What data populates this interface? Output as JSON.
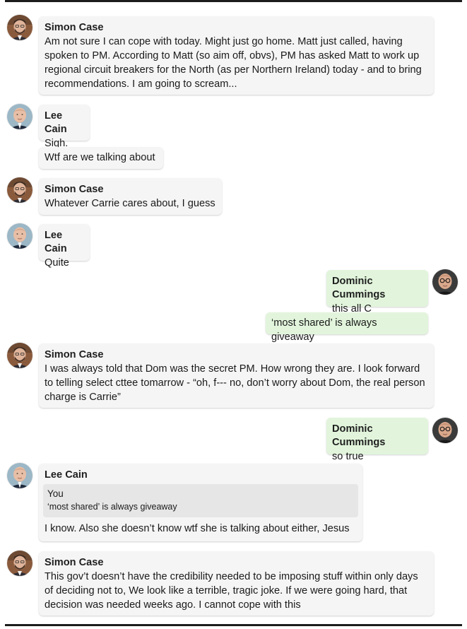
{
  "messages": [
    {
      "sender": "Simon Case",
      "text": "Am not sure I can cope with today. Might just go home. Matt just called, having spoken to PM. According to Matt (so aim off, obvs), PM has asked Matt to work up regional circuit breakers for the North (as per Northern Ireland) today - and to bring recommendations. I am going to scream..."
    },
    {
      "sender": "Lee Cain",
      "text": "Sigh."
    },
    {
      "sender": "",
      "text": "Wtf are we talking about"
    },
    {
      "sender": "Simon Case",
      "text": "Whatever Carrie cares about, I guess"
    },
    {
      "sender": "Lee Cain",
      "text": "Quite"
    },
    {
      "sender": "Dominic Cummings",
      "text": "this all C"
    },
    {
      "sender": "",
      "text": "‘most shared’ is always giveaway"
    },
    {
      "sender": "Simon Case",
      "text": "I was always told that Dom was the secret PM. How wrong they are. I look forward to telling select cttee tomarrow - “oh, f--- no, don’t worry about Dom, the real person charge is Carrie”"
    },
    {
      "sender": "Dominic Cummings",
      "text": "so true"
    },
    {
      "sender": "Lee Cain",
      "reply_to": {
        "name": "You",
        "text": "‘most shared’ is always giveaway"
      },
      "text": "I know. Also she doesn’t know wtf she is talking about either, Jesus"
    },
    {
      "sender": "Simon Case",
      "text": "This gov’t doesn’t have the credibility needed to be imposing stuff within only days of deciding not to, We look like a terrible, tragic joke. If we were going hard, that decision was needed weeks ago. I cannot cope with this"
    }
  ],
  "colors": {
    "incoming_bubble": "#f5f5f5",
    "outgoing_bubble": "#e2f5dc",
    "rule": "#1c1c1c"
  }
}
